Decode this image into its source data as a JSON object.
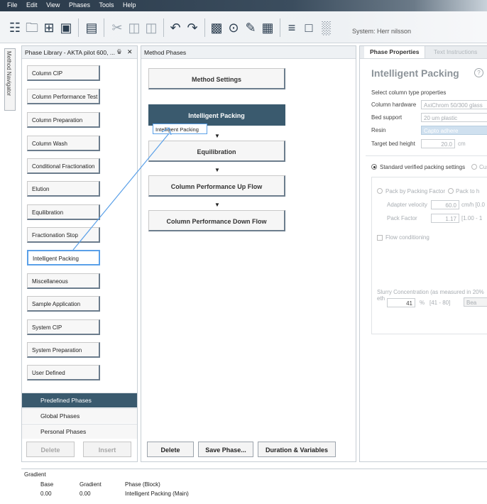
{
  "menu": [
    "File",
    "Edit",
    "View",
    "Phases",
    "Tools",
    "Help"
  ],
  "toolbar": {
    "icons": [
      "new-method-icon",
      "open-folder-icon",
      "compare-icon",
      "save-icon",
      "print-icon",
      "cut-icon",
      "copy-icon",
      "paste-icon",
      "undo-icon",
      "redo-icon",
      "run-icon",
      "record-icon",
      "edit-icon",
      "report-icon",
      "settings-icon",
      "frame-icon",
      "chart-icon"
    ],
    "system_text": "System: Herr nilsson"
  },
  "navigator_tab": "Method Navigator",
  "library": {
    "title": "Phase Library - AKTA pilot 600, ...",
    "pin_glyph": "ɨ",
    "close_glyph": "✕",
    "items": [
      "Column CIP",
      "Column Performance Test",
      "Column Preparation",
      "Column Wash",
      "Conditional Fractionation",
      "Elution",
      "Equilibration",
      "Fractionation Stop",
      "Intelligent Packing",
      "Miscellaneous",
      "Sample Application",
      "System CIP",
      "System Preparation",
      "User Defined"
    ],
    "tabs": [
      "Predefined Phases",
      "Global Phases",
      "Personal Phases"
    ],
    "delete_label": "Delete",
    "insert_label": "Insert"
  },
  "method_phases": {
    "title": "Method Phases",
    "settings": "Method Settings",
    "phases": [
      "Intelligent Packing",
      "Equilibration",
      "Column Performance Up Flow",
      "Column Performance Down Flow"
    ],
    "drag_label": "Intelligent Packing",
    "delete_label": "Delete",
    "save_label": "Save Phase...",
    "duration_label": "Duration & Variables"
  },
  "properties": {
    "tab_active": "Phase Properties",
    "tab_inactive": "Text Instructions",
    "title": "Intelligent Packing",
    "help_glyph": "?",
    "select_type": "Select column type properties",
    "column_hardware_label": "Column hardware",
    "column_hardware_value": "AxiChrom 50/300 glass",
    "bed_support_label": "Bed support",
    "bed_support_value": "20 um plastic",
    "resin_label": "Resin",
    "resin_value": "Capto adhere",
    "target_height_label": "Target bed height",
    "target_height_value": "20.0",
    "target_height_unit": "cm",
    "standard_label": "Standard verified packing settings",
    "custom_label": "Cust",
    "pack_factor_label": "Pack by Packing Factor",
    "pack_other_label": "Pack to h",
    "adapter_velocity_label": "Adapter velocity",
    "adapter_velocity_value": "60.0",
    "adapter_velocity_unit": "cm/h [0.0",
    "pack_factor_field_label": "Pack Factor",
    "pack_factor_value": "1.17",
    "pack_factor_range": "[1.00 - 1",
    "flow_label": "Flow conditioning",
    "slurry_label": "Slurry Concentration (as measured in 20% eth",
    "slurry_value": "41",
    "slurry_unit": "%",
    "slurry_range": "[41 - 80]",
    "slurry_btn": "Bea"
  },
  "gradient": {
    "title": "Gradient",
    "headers": [
      "Base",
      "Gradient",
      "Phase (Block)"
    ],
    "row": [
      "0.00",
      "0.00",
      "Intelligent Packing (Main)"
    ]
  }
}
